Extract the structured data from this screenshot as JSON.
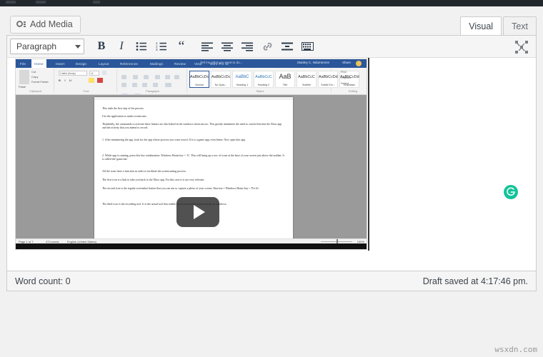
{
  "adminbar": {
    "present": true
  },
  "editor": {
    "add_media_label": "Add Media",
    "tabs": [
      {
        "label": "Visual",
        "active": true
      },
      {
        "label": "Text",
        "active": false
      }
    ],
    "toolbar": {
      "style_value": "Paragraph",
      "buttons": [
        {
          "name": "bold",
          "glyph": "B"
        },
        {
          "name": "italic",
          "glyph": "I"
        },
        {
          "name": "bulleted-list",
          "glyph": "☰"
        },
        {
          "name": "numbered-list",
          "glyph": "☰"
        },
        {
          "name": "blockquote",
          "glyph": "“"
        },
        {
          "name": "align-left",
          "glyph": "≡"
        },
        {
          "name": "align-center",
          "glyph": "≡"
        },
        {
          "name": "align-right",
          "glyph": "≡"
        },
        {
          "name": "insert-link",
          "glyph": "🔗"
        },
        {
          "name": "read-more",
          "glyph": "—"
        },
        {
          "name": "toolbar-toggle",
          "glyph": "⌨"
        }
      ],
      "fullscreen_label": "Distraction-free writing mode"
    },
    "status": {
      "word_count": "Word count: 0",
      "draft_saved": "Draft saved at 4:17:46 pm."
    }
  },
  "embed": {
    "type": "video",
    "play_button": "play-button",
    "grammarly_badge": "G",
    "word_screenshot": {
      "ribbon_tabs": [
        "File",
        "Home",
        "Insert",
        "Design",
        "Layout",
        "References",
        "Mailings",
        "Review",
        "View",
        "Nitro Pro 11"
      ],
      "active_tab": "Home",
      "tell_me": "Tell me what you want to do...",
      "user": "Stanley C. Ndumereze",
      "share_label": "Share",
      "groups": [
        {
          "label": "Clipboard"
        },
        {
          "label": "Font"
        },
        {
          "label": "Paragraph"
        },
        {
          "label": "Styles"
        },
        {
          "label": "Editing"
        }
      ],
      "clipboard_items": [
        "Cut",
        "Copy",
        "Format Painter",
        "Paste"
      ],
      "font_value": "Calibri (Body)",
      "font_size": "11",
      "styles": [
        {
          "preview": "AaBbCcDc",
          "name": "Normal",
          "active": true
        },
        {
          "preview": "AaBbCcDc",
          "name": "No Spac..."
        },
        {
          "preview": "AaBbC",
          "name": "Heading 1"
        },
        {
          "preview": "AaBbCcC",
          "name": "Heading 2"
        },
        {
          "preview": "AaB",
          "name": "Title"
        },
        {
          "preview": "AaBbCcC",
          "name": "Subtitle"
        },
        {
          "preview": "AaBbCcDd",
          "name": "Subtle Em..."
        },
        {
          "preview": "AaBbCcDd",
          "name": "Emphasis"
        }
      ],
      "editing_items": [
        "Find",
        "Replace",
        "Select"
      ],
      "document_paragraphs": [
        "This ends the first step of the process.",
        "Use the application to make screencasts",
        "Thankfully, the commands to activate these feature are also baked in the windows shortcuts too. This greatly minimizes the need to switch between the Xbox app and the activity that you intend to record.",
        "1. After minimizing the app, look for the app whose process you want record. If it is a game app, even better. Now open this app.",
        "2. While app is running, press this key combination: Windows Home key + 'G'. This will bring up a row of icons at the base of your screen just above the taskbar. It is called the 'game bar'.",
        "All the icons have a function in order to facilitate the screencasting process.",
        "The first icon is a link to take you back to the Xbox app. For this case it is not very relevant.",
        "The second icon is the regular screenshot button that you can use to capture a photo of your screen. Shortcut = Windows Home key + 'Prt Sc'.",
        "The third icon is the recording tool. It is the actual tool that enable you to record the recent activity on windows."
      ],
      "status_bar": {
        "page": "Page 1 of 7",
        "words": "474 words",
        "language": "English (United States)",
        "zoom": "100%"
      }
    }
  },
  "watermark": "wsxdn.com"
}
